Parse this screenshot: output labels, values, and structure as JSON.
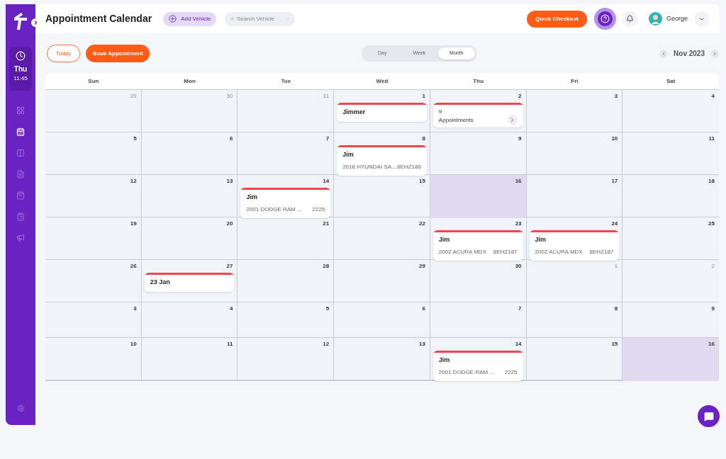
{
  "sidebar": {
    "day": "Thu",
    "time": "11:45",
    "nav_items": [
      {
        "selected": false
      },
      {
        "selected": true
      },
      {
        "selected": false
      },
      {
        "selected": false
      },
      {
        "selected": false
      },
      {
        "selected": false
      },
      {
        "selected": false
      }
    ]
  },
  "header": {
    "title": "Appointment Calendar",
    "add_button": "Add Vehicle",
    "search": {
      "placeholder": "Search Vehicle"
    },
    "checkout_button": "Quick Checkout",
    "user": "George"
  },
  "toolbar": {
    "today_button": "Today",
    "book_button": "Book Appointment",
    "views": [
      {
        "label": "Day",
        "selected": false
      },
      {
        "label": "Week",
        "selected": false
      },
      {
        "label": "Month",
        "selected": true
      }
    ],
    "month": "Nov 2023"
  },
  "weekdays": [
    "Sun",
    "Mon",
    "Tue",
    "Wed",
    "Thu",
    "Fri",
    "Sat"
  ],
  "weeks": [
    [
      {
        "day": "29",
        "muted": true,
        "highlighted": false
      },
      {
        "day": "30",
        "muted": true,
        "highlighted": false
      },
      {
        "day": "31",
        "muted": true,
        "highlighted": false
      },
      {
        "day": "1",
        "muted": false,
        "highlighted": false,
        "appointment": {
          "kind": "single",
          "name": "Jimmer"
        }
      },
      {
        "day": "2",
        "muted": false,
        "highlighted": false,
        "appointment": {
          "kind": "summary",
          "count": "9",
          "label": "Appointments"
        }
      },
      {
        "day": "3",
        "muted": false,
        "highlighted": false
      },
      {
        "day": "4",
        "muted": false,
        "highlighted": false
      }
    ],
    [
      {
        "day": "5",
        "muted": false,
        "highlighted": false
      },
      {
        "day": "6",
        "muted": false,
        "highlighted": false
      },
      {
        "day": "7",
        "muted": false,
        "highlighted": false
      },
      {
        "day": "8",
        "muted": false,
        "highlighted": false,
        "appointment": {
          "kind": "single",
          "name": "Jim",
          "vehicle": "2018 HYUNDAI SA...",
          "plate": "8EHZ186"
        }
      },
      {
        "day": "9",
        "muted": false,
        "highlighted": false
      },
      {
        "day": "10",
        "muted": false,
        "highlighted": false
      },
      {
        "day": "11",
        "muted": false,
        "highlighted": false
      }
    ],
    [
      {
        "day": "12",
        "muted": false,
        "highlighted": false
      },
      {
        "day": "13",
        "muted": false,
        "highlighted": false
      },
      {
        "day": "14",
        "muted": false,
        "highlighted": false,
        "appointment": {
          "kind": "single",
          "name": "Jim",
          "vehicle": "2001 DODGE RAM ...",
          "plate": "2225"
        }
      },
      {
        "day": "15",
        "muted": false,
        "highlighted": false
      },
      {
        "day": "16",
        "muted": false,
        "highlighted": true
      },
      {
        "day": "17",
        "muted": false,
        "highlighted": false
      },
      {
        "day": "18",
        "muted": false,
        "highlighted": false
      }
    ],
    [
      {
        "day": "19",
        "muted": false,
        "highlighted": false
      },
      {
        "day": "20",
        "muted": false,
        "highlighted": false
      },
      {
        "day": "21",
        "muted": false,
        "highlighted": false
      },
      {
        "day": "22",
        "muted": false,
        "highlighted": false
      },
      {
        "day": "23",
        "muted": false,
        "highlighted": false,
        "appointment": {
          "kind": "single",
          "name": "Jim",
          "vehicle": "2002 ACURA MDX",
          "plate": "8EHZ187"
        }
      },
      {
        "day": "24",
        "muted": false,
        "highlighted": false,
        "appointment": {
          "kind": "single",
          "name": "Jim",
          "vehicle": "2002 ACURA MDX",
          "plate": "8EHZ187"
        }
      },
      {
        "day": "25",
        "muted": false,
        "highlighted": false
      }
    ],
    [
      {
        "day": "26",
        "muted": false,
        "highlighted": false
      },
      {
        "day": "27",
        "muted": false,
        "highlighted": false,
        "appointment": {
          "kind": "single",
          "name": "23 Jan"
        }
      },
      {
        "day": "28",
        "muted": false,
        "highlighted": false
      },
      {
        "day": "29",
        "muted": false,
        "highlighted": false
      },
      {
        "day": "30",
        "muted": false,
        "highlighted": false
      },
      {
        "day": "1",
        "muted": true,
        "highlighted": false
      },
      {
        "day": "2",
        "muted": true,
        "highlighted": false
      }
    ],
    [
      {
        "day": "3",
        "muted": false,
        "highlighted": false
      },
      {
        "day": "4",
        "muted": false,
        "highlighted": false
      },
      {
        "day": "5",
        "muted": false,
        "highlighted": false
      },
      {
        "day": "6",
        "muted": false,
        "highlighted": false
      },
      {
        "day": "7",
        "muted": false,
        "highlighted": false
      },
      {
        "day": "8",
        "muted": false,
        "highlighted": false
      },
      {
        "day": "9",
        "muted": false,
        "highlighted": false
      }
    ],
    [
      {
        "day": "10",
        "muted": false,
        "highlighted": false
      },
      {
        "day": "11",
        "muted": false,
        "highlighted": false
      },
      {
        "day": "12",
        "muted": false,
        "highlighted": false
      },
      {
        "day": "13",
        "muted": false,
        "highlighted": false
      },
      {
        "day": "14",
        "muted": false,
        "highlighted": false,
        "appointment": {
          "kind": "single",
          "name": "Jim",
          "vehicle": "2001 DODGE RAM ...",
          "plate": "2225"
        }
      },
      {
        "day": "15",
        "muted": false,
        "highlighted": false
      },
      {
        "day": "16",
        "muted": false,
        "highlighted": true
      }
    ]
  ]
}
